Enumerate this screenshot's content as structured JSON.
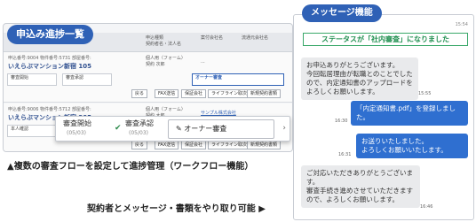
{
  "left": {
    "title": "申込み進捗一覧",
    "header": {
      "col1": "申込番号",
      "col2": "申込種類\n契約者名・法人名",
      "col3": "案付会社名",
      "col4": "流通元会社名"
    },
    "records": [
      {
        "meta": "申込番号:9004 物件番号:5731 部屋番号:",
        "name": "いえらぶマンション新宿 105",
        "type": "個人用（フォーム）",
        "person": "契約 次郎",
        "company": "...",
        "flow": [
          "審査開始",
          "審査承認",
          "オーナー審査"
        ],
        "buttons": [
          "戻る",
          "FAX送信",
          "保証会社",
          "ライフライン取次",
          "新規契約書類"
        ]
      },
      {
        "meta": "申込番号:9006 物件番号:5712 部屋番号:",
        "name": "いえらぶマンション新宿 205",
        "type": "個人用（フォーム）",
        "person": "契約 太郎",
        "company": "サンプル株式会社",
        "flow": [
          "本人確認"
        ],
        "buttons": [
          "戻る",
          "FAX送信",
          "保証会社",
          "ライフライン取次",
          "新規契約書類"
        ]
      }
    ],
    "popup": {
      "step1": "審査開始",
      "date1": "(05/03)",
      "step2": "審査承認",
      "date2": "(05/03)",
      "active": "オーナー審査"
    },
    "caption": "▲複数の審査フローを設定して進捗管理（ワークフロー機能）"
  },
  "right": {
    "title": "メッセージ機能",
    "top_time": "15:54",
    "status": "ステータスが「社内審査」になりました",
    "messages": [
      {
        "dir": "in",
        "text": "お申込ありがとうございます。\n今回転居理由が転職とのことでしたので、内定通知書のアップロードをよろしくお願いします。",
        "time": "15:55"
      },
      {
        "dir": "out",
        "text": "「内定通知書.pdf」を登録しました。",
        "time": "16:30"
      },
      {
        "dir": "out",
        "text": "お送りいたしました。\nよろしくお願いいたします。",
        "time": "16:31"
      },
      {
        "dir": "in",
        "text": "ご対応いただきありがとうございます。\n審査手続き進めさせていただきますので、よろしくお願いします。",
        "time": "16:46"
      }
    ]
  },
  "caption_bottom": "契約者とメッセージ・書類をやり取り可能 ▶",
  "colors": {
    "accent": "#2f61b6",
    "status_green": "#1f8f4f",
    "bubble_out": "#2f6fd0"
  }
}
